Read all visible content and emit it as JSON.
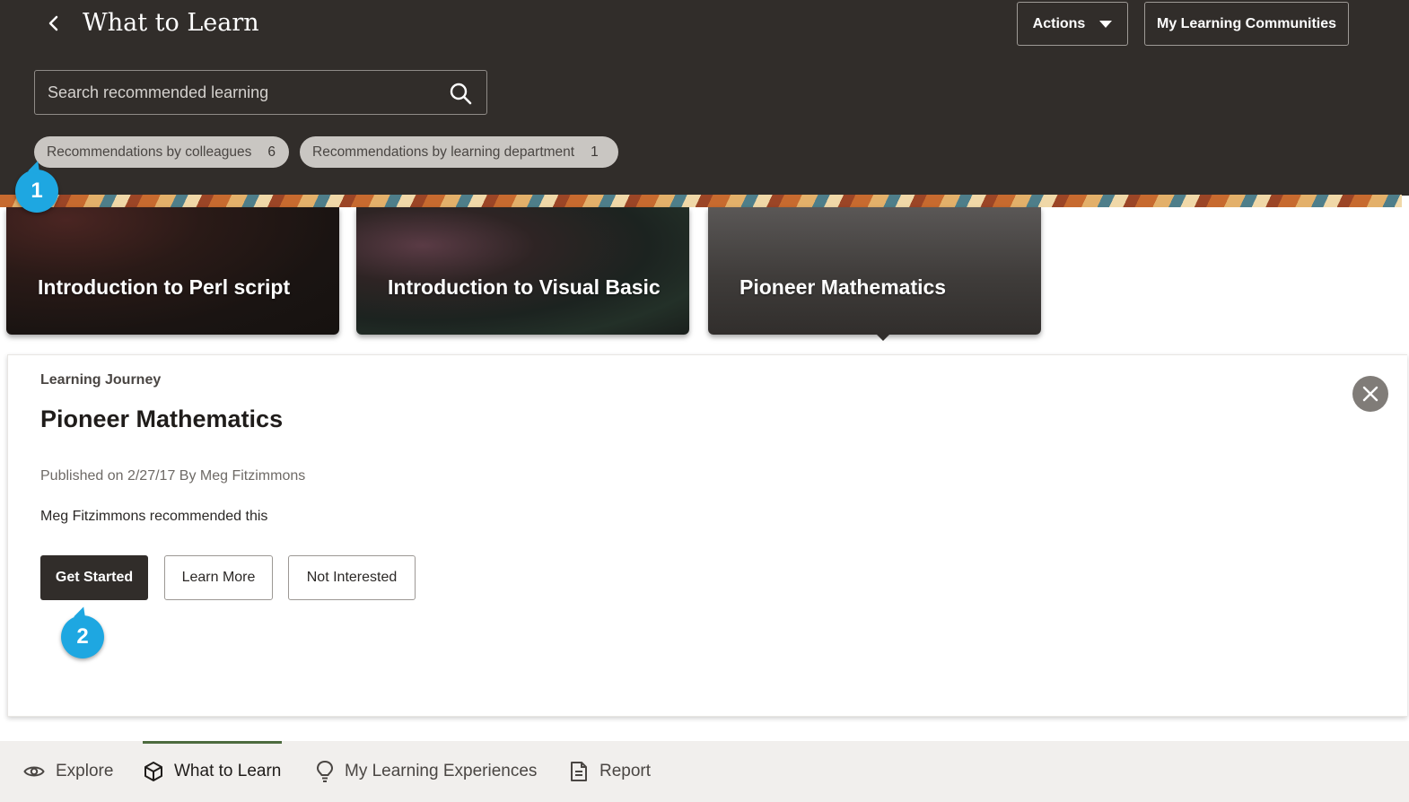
{
  "header": {
    "title": "What to Learn",
    "actions_label": "Actions",
    "communities_label": "My Learning Communities"
  },
  "search": {
    "placeholder": "Search recommended learning"
  },
  "filters": [
    {
      "label": "Recommendations by colleagues",
      "count": "6"
    },
    {
      "label": "Recommendations by learning department",
      "count": "1"
    }
  ],
  "cards": [
    {
      "title": "Introduction to Perl script"
    },
    {
      "title": "Introduction to Visual Basic"
    },
    {
      "title": "Pioneer Mathematics"
    }
  ],
  "detail": {
    "type": "Learning Journey",
    "title": "Pioneer Mathematics",
    "published": "Published on 2/27/17 By Meg Fitzimmons",
    "recommended": "Meg Fitzimmons recommended this",
    "get_started_label": "Get Started",
    "learn_more_label": "Learn More",
    "not_interested_label": "Not Interested"
  },
  "callouts": [
    "1",
    "2"
  ],
  "bottom_nav": {
    "tabs": [
      {
        "label": "Explore",
        "icon": "eye-icon"
      },
      {
        "label": "What to Learn",
        "icon": "cube-icon",
        "active": true
      },
      {
        "label": "My Learning Experiences",
        "icon": "lightbulb-icon"
      },
      {
        "label": "Report",
        "icon": "report-icon"
      }
    ]
  },
  "colors": {
    "header_bg": "#312d2a",
    "callout": "#1ea7e1",
    "active_tab_underline": "#4d6b3f"
  }
}
